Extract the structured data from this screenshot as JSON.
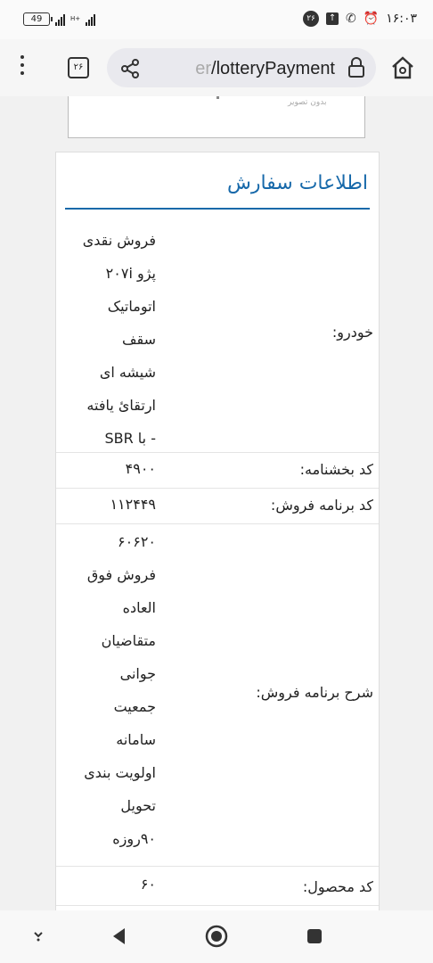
{
  "status_bar": {
    "battery": "49",
    "time": "۱۶:۰۳",
    "notification_count": "۲۶",
    "net_label": "H+"
  },
  "browser": {
    "tab_count": "۲۶",
    "url_faded": "er",
    "url": "/lotteryPayment"
  },
  "page": {
    "image_caption": "بدون تصویر",
    "section_title": "اطلاعات سفارش",
    "rows": [
      {
        "label": "خودرو:",
        "lines": [
          "فروش نقدی",
          "پژو ۲۰۷i",
          "اتوماتیک",
          "سقف",
          "شیشه ای",
          "ارتقائ یافته",
          "- با SBR"
        ]
      },
      {
        "label": "کد بخشنامه:",
        "lines": [
          "۴۹۰۰"
        ]
      },
      {
        "label": "کد برنامه فروش:",
        "lines": [
          "۱۱۲۴۴۹"
        ]
      },
      {
        "label": "شرح برنامه فروش:",
        "lines": [
          "۶۰۶۲۰",
          "فروش فوق",
          "العاده",
          "متقاضیان",
          "جوانی",
          "جمعیت",
          "سامانه",
          "اولویت بندی",
          "تحویل",
          "۹۰روزه"
        ]
      },
      {
        "label": "کد محصول:",
        "lines": [
          "۶۰"
        ]
      }
    ]
  },
  "colors": {
    "accent": "#1769aa"
  }
}
